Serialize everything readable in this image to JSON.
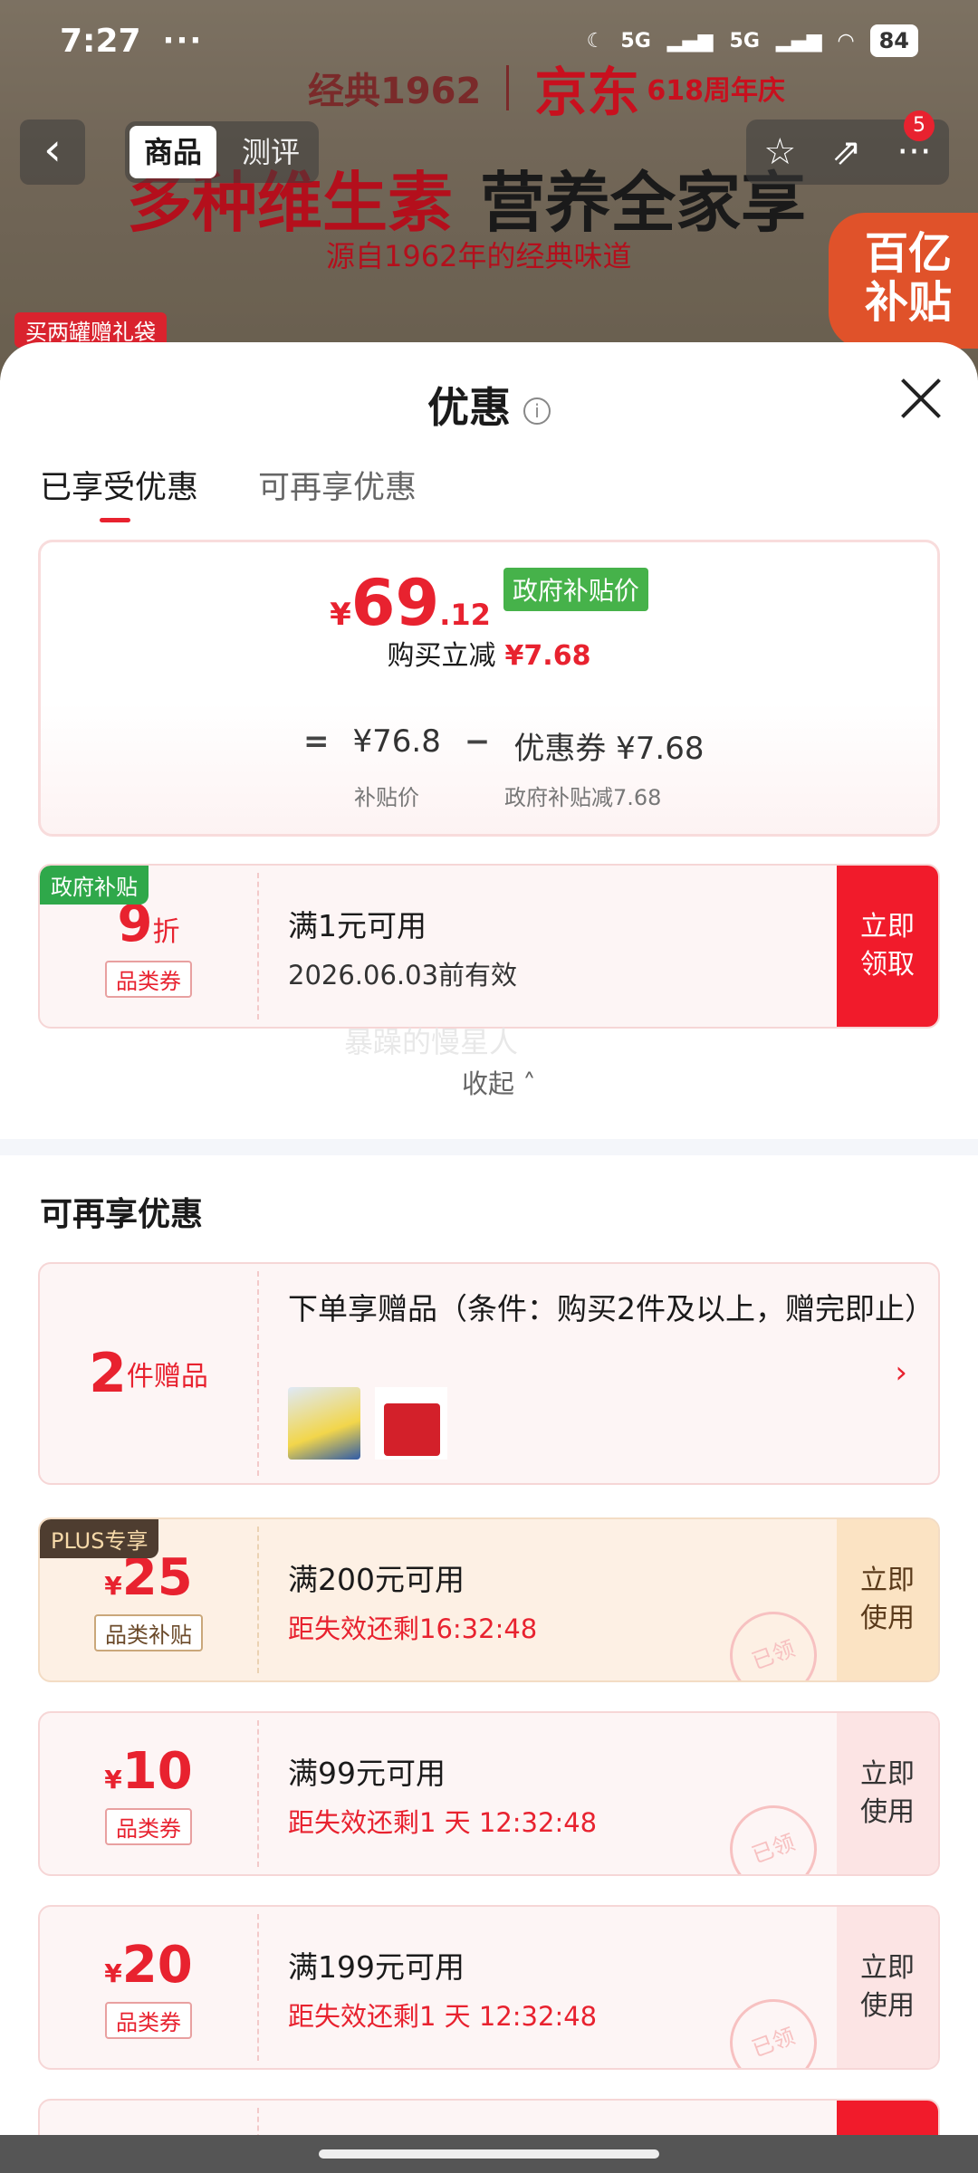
{
  "status_bar": {
    "time": "7:27",
    "overflow": "···",
    "network1": "5G",
    "network2": "5G",
    "battery": "84"
  },
  "background": {
    "brand_left": "经典1962",
    "brand_right": "京东",
    "brand_618": "618周年庆",
    "headline_red": "多种维生素",
    "headline_black": "营养全家享",
    "subline": "源自1962年的经典味道",
    "gift_tag": "买两罐赠礼袋",
    "subsidy_badge_l1": "百亿",
    "subsidy_badge_l2": "补贴",
    "nav": {
      "back": "‹",
      "tab_product": "商品",
      "tab_review": "测评",
      "star": "☆",
      "share": "⇗",
      "more": "···",
      "badge_count": "5"
    }
  },
  "sheet": {
    "title": "优惠",
    "info_icon": "i",
    "tabs": [
      "已享受优惠",
      "可再享优惠"
    ],
    "price": {
      "currency": "¥",
      "integer": "69",
      "decimal": ".12",
      "tag": "政府补贴价",
      "reduce_label": "购买立减",
      "reduce_amount": "¥7.68",
      "eq": "=",
      "base_price": "¥76.8",
      "minus": "−",
      "coupon_label": "优惠券 ¥7.68",
      "base_note": "补贴价",
      "coupon_note": "政府补贴减7.68"
    },
    "applied_coupon": {
      "corner": "政府补贴",
      "value": "9",
      "unit": "折",
      "kind": "品类券",
      "condition": "满1元可用",
      "validity": "2026.06.03前有效",
      "action_l1": "立即",
      "action_l2": "领取"
    },
    "watermark": "暴躁的慢星人",
    "collapse": "收起 ˄",
    "section_title": "可再享优惠",
    "gift": {
      "num": "2",
      "unit": "件赠品",
      "text": "下单享赠品（条件：购买2件及以上，赠完即止）",
      "arrow": "›"
    },
    "more_coupons": [
      {
        "corner": "PLUS专享",
        "currency": "¥",
        "value": "25",
        "kind": "品类补贴",
        "condition": "满200元可用",
        "countdown": "距失效还剩16:32:48",
        "action_l1": "立即",
        "action_l2": "使用",
        "stamp": "已领"
      },
      {
        "corner": "",
        "currency": "¥",
        "value": "10",
        "kind": "品类券",
        "condition": "满99元可用",
        "countdown": "距失效还剩1 天 12:32:48",
        "action_l1": "立即",
        "action_l2": "使用",
        "stamp": "已领"
      },
      {
        "corner": "",
        "currency": "¥",
        "value": "20",
        "kind": "品类券",
        "condition": "满199元可用",
        "countdown": "距失效还剩1 天 12:32:48",
        "action_l1": "立即",
        "action_l2": "使用",
        "stamp": "已领"
      }
    ]
  },
  "colors": {
    "accent": "#e8222f",
    "gov_green": "#46b24a",
    "plus_brown": "#4e3d30"
  }
}
